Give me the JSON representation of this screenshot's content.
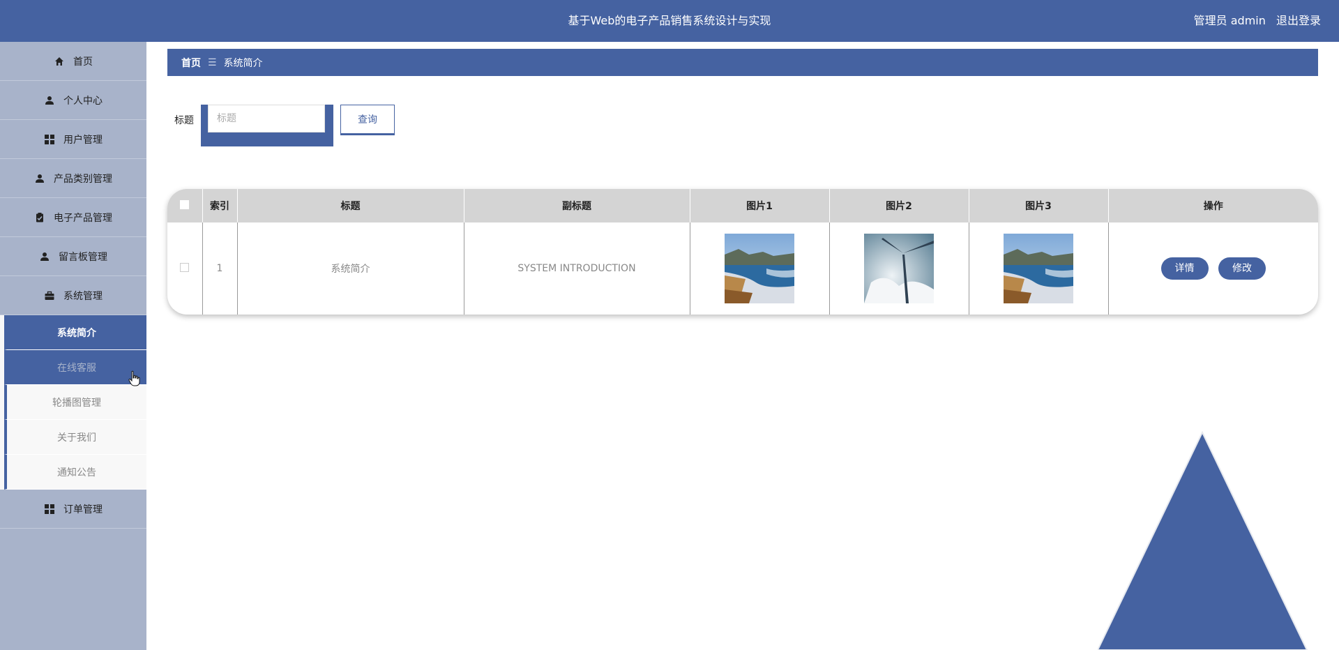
{
  "header": {
    "title": "基于Web的电子产品销售系统设计与实现",
    "user": "管理员 admin",
    "logout": "退出登录"
  },
  "sidebar": {
    "items": [
      {
        "label": "首页",
        "icon": "home-icon"
      },
      {
        "label": "个人中心",
        "icon": "person-icon"
      },
      {
        "label": "用户管理",
        "icon": "grid-icon"
      },
      {
        "label": "产品类别管理",
        "icon": "person-icon"
      },
      {
        "label": "电子产品管理",
        "icon": "clipboard-icon"
      },
      {
        "label": "留言板管理",
        "icon": "person-icon"
      },
      {
        "label": "系统管理",
        "icon": "briefcase-icon"
      }
    ],
    "submenu": [
      {
        "label": "系统简介"
      },
      {
        "label": "在线客服"
      },
      {
        "label": "轮播图管理"
      },
      {
        "label": "关于我们"
      },
      {
        "label": "通知公告"
      }
    ],
    "last": {
      "label": "订单管理",
      "icon": "grid-icon"
    }
  },
  "breadcrumb": {
    "home": "首页",
    "sep": "☰",
    "current": "系统简介"
  },
  "search": {
    "label": "标题",
    "placeholder": "标题",
    "button": "查询"
  },
  "table": {
    "headers": [
      "索引",
      "标题",
      "副标题",
      "图片1",
      "图片2",
      "图片3",
      "操作"
    ],
    "rows": [
      {
        "index": "1",
        "title": "系统简介",
        "subtitle": "SYSTEM INTRODUCTION",
        "detail": "详情",
        "edit": "修改"
      }
    ]
  },
  "colors": {
    "primary": "#4562a1",
    "sidebar": "#a8b3ca"
  }
}
